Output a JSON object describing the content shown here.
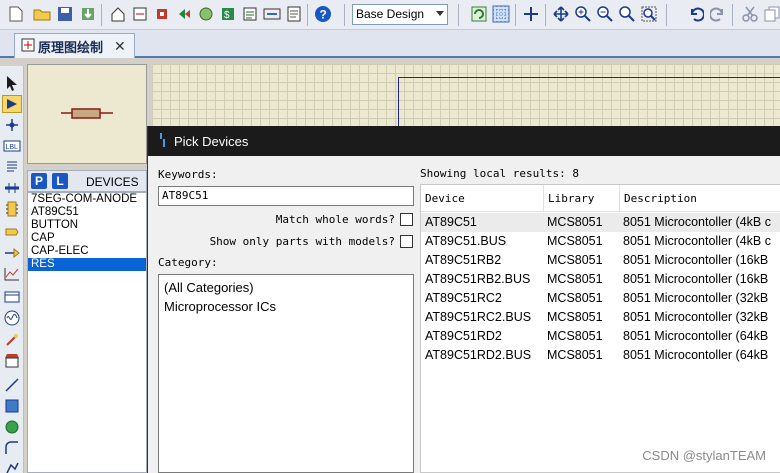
{
  "toolbar": {
    "design_select": "Base Design"
  },
  "tab": {
    "title": "原理图绘制"
  },
  "devices_panel": {
    "p_button": "P",
    "l_button": "L",
    "label": "DEVICES",
    "items": [
      "7SEG-COM-ANODE",
      "AT89C51",
      "BUTTON",
      "CAP",
      "CAP-ELEC",
      "RES"
    ],
    "selected": "RES"
  },
  "dialog": {
    "title": "Pick Devices",
    "keywords_label": "Keywords:",
    "keywords_value": "AT89C51",
    "match_whole_words_label": "Match whole words?",
    "show_only_models_label": "Show only parts with models?",
    "category_label": "Category:",
    "categories": [
      "(All Categories)",
      "Microprocessor ICs"
    ],
    "results_summary": "Showing local results: 8",
    "columns": [
      "Device",
      "Library",
      "Description"
    ],
    "rows": [
      {
        "device": "AT89C51",
        "library": "MCS8051",
        "description": "8051 Microcontoller (4kB c"
      },
      {
        "device": "AT89C51.BUS",
        "library": "MCS8051",
        "description": "8051 Microcontoller (4kB c"
      },
      {
        "device": "AT89C51RB2",
        "library": "MCS8051",
        "description": "8051 Microcontoller (16kB"
      },
      {
        "device": "AT89C51RB2.BUS",
        "library": "MCS8051",
        "description": "8051 Microcontoller (16kB"
      },
      {
        "device": "AT89C51RC2",
        "library": "MCS8051",
        "description": "8051 Microcontoller (32kB"
      },
      {
        "device": "AT89C51RC2.BUS",
        "library": "MCS8051",
        "description": "8051 Microcontoller (32kB"
      },
      {
        "device": "AT89C51RD2",
        "library": "MCS8051",
        "description": "8051 Microcontoller (64kB"
      },
      {
        "device": "AT89C51RD2.BUS",
        "library": "MCS8051",
        "description": "8051 Microcontoller (64kB"
      }
    ]
  },
  "watermark": "CSDN @stylanTEAM",
  "colors": {
    "selection": "#0a64d8",
    "dialog_title_bg": "#1b1b1b",
    "canvas_bg": "#ece9d0"
  }
}
